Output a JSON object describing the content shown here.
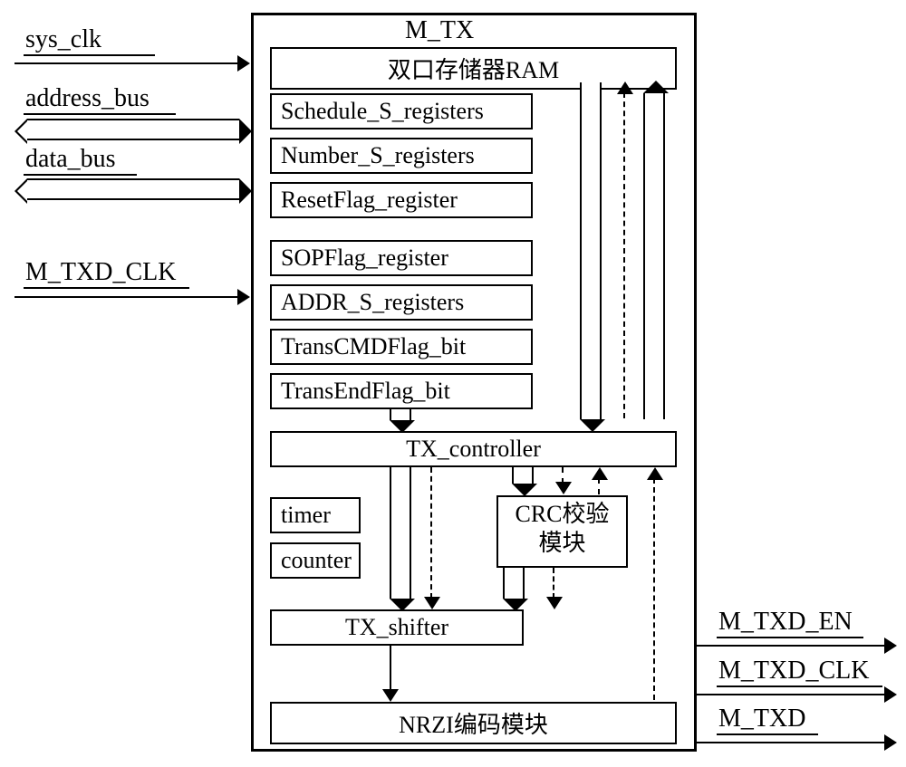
{
  "title": "M_TX",
  "inputs": {
    "sys_clk": "sys_clk",
    "address_bus": "address_bus",
    "data_bus": "data_bus",
    "m_txd_clk": "M_TXD_CLK"
  },
  "outputs": {
    "m_txd_en": "M_TXD_EN",
    "m_txd_clk": "M_TXD_CLK",
    "m_txd": "M_TXD"
  },
  "blocks": {
    "ram": "双口存储器RAM",
    "schedule": "Schedule_S_registers",
    "number": "Number_S_registers",
    "resetflag": "ResetFlag_register",
    "sopflag": "SOPFlag_register",
    "addr": "ADDR_S_registers",
    "transcmd": "TransCMDFlag_bit",
    "transend": "TransEndFlag_bit",
    "controller": "TX_controller",
    "timer": "timer",
    "counter": "counter",
    "crc": "CRC校验模块",
    "shifter": "TX_shifter",
    "nrzi": "NRZI编码模块"
  }
}
